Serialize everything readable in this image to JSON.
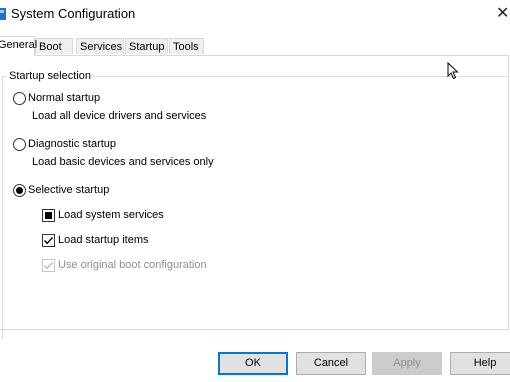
{
  "window": {
    "title": "System Configuration",
    "close_glyph": "✕"
  },
  "tabs": [
    {
      "label": "General",
      "active": true
    },
    {
      "label": "Boot",
      "active": false
    },
    {
      "label": "Services",
      "active": false
    },
    {
      "label": "Startup",
      "active": false
    },
    {
      "label": "Tools",
      "active": false
    }
  ],
  "startup_selection": {
    "group_label": "Startup selection",
    "normal": {
      "label": "Normal startup",
      "description": "Load all device drivers and services",
      "selected": false
    },
    "diagnostic": {
      "label": "Diagnostic startup",
      "description": "Load basic devices and services only",
      "selected": false
    },
    "selective": {
      "label": "Selective startup",
      "selected": true,
      "options": {
        "system_services": {
          "label": "Load system services",
          "state": "indeterminate"
        },
        "startup_items": {
          "label": "Load startup items",
          "state": "checked"
        },
        "original_boot": {
          "label": "Use original boot configuration",
          "state": "checked-disabled"
        }
      }
    }
  },
  "buttons": {
    "ok": "OK",
    "cancel": "Cancel",
    "apply": "Apply",
    "help": "Help"
  },
  "icons": {
    "app": "msconfig-icon",
    "cursor": "mouse-pointer-icon"
  },
  "colors": {
    "accent": "#0078d7",
    "disabled_text": "#8f8f8f",
    "button_face": "#e1e1e1"
  }
}
